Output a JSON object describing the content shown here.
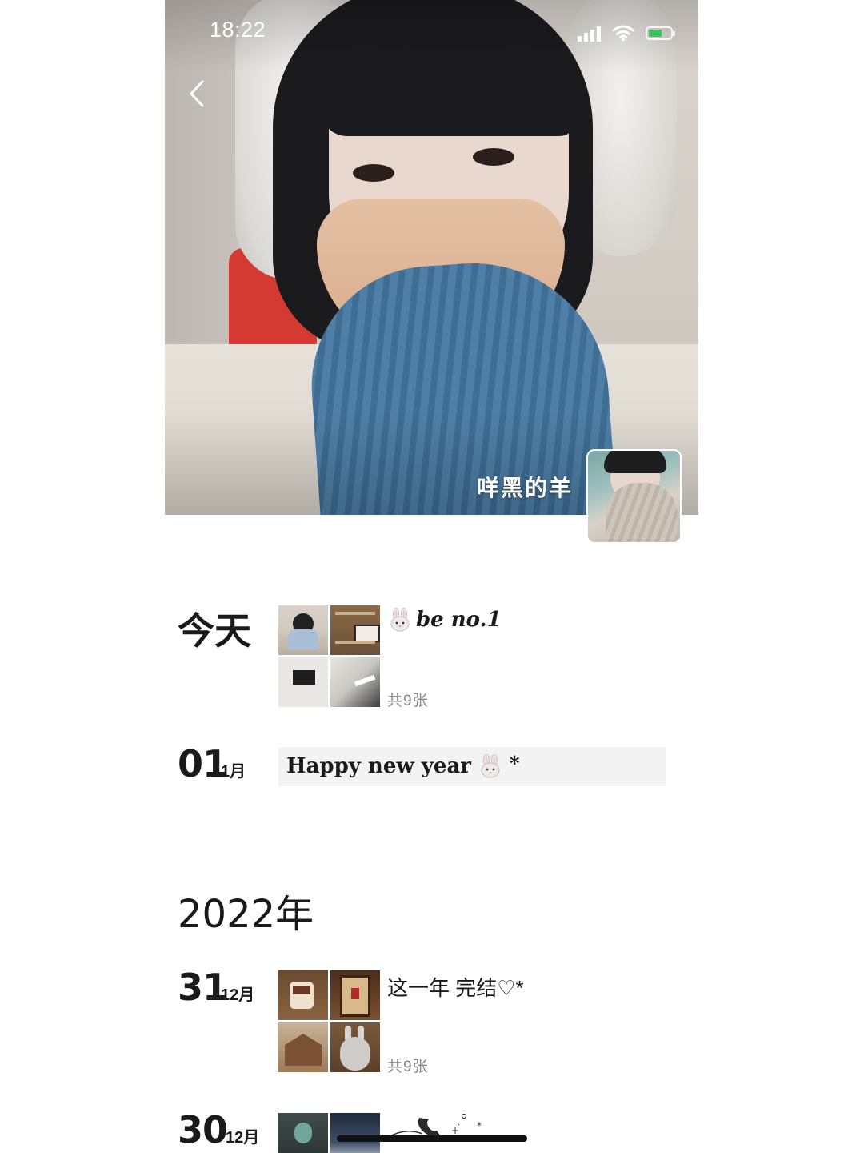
{
  "status_bar": {
    "time": "18:22",
    "battery_color": "#35c759"
  },
  "header": {
    "back_icon": "chevron-left-icon",
    "profile_name": "咩黑的羊"
  },
  "timeline": {
    "today": {
      "label": "今天",
      "caption_emoji": "rabbit-face-icon",
      "caption_text": "be no.1",
      "count": "共9张"
    },
    "jan01": {
      "day": "01",
      "month": "1月",
      "text": "Happy new year",
      "trailing": "*"
    },
    "year_2022": "2022年",
    "dec31": {
      "day": "31",
      "month": "12月",
      "caption": "这一年 完结♡*",
      "count": "共9张"
    },
    "dec30": {
      "day": "30",
      "month": "12月"
    }
  },
  "colors": {
    "text_primary": "#1a1a1a",
    "text_secondary": "#888888",
    "card_bg": "#f3f3f3"
  }
}
